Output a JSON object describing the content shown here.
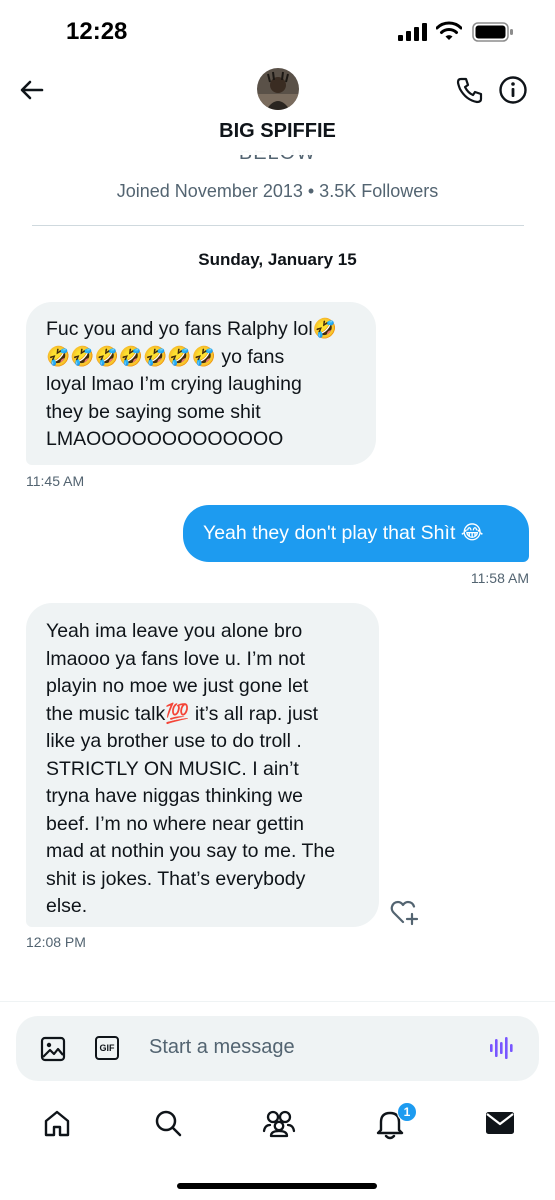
{
  "status_bar": {
    "time": "12:28",
    "icons": [
      "signal-icon",
      "wifi-icon",
      "battery-icon"
    ]
  },
  "header": {
    "contact_name": "BIG SPIFFIE",
    "icons": [
      "back-arrow-icon",
      "avatar",
      "phone-icon",
      "info-icon"
    ]
  },
  "profile": {
    "bio_cut": "BELOW",
    "joined_text": "Joined November 2013 • 3.5K Followers"
  },
  "conversation": {
    "date_separator": "Sunday, January 15",
    "messages": [
      {
        "direction": "incoming",
        "lines": [
          "Fuc you and yo fans Ralphy lol🤣",
          "🤣🤣🤣🤣🤣🤣🤣 yo fans",
          "loyal lmao I’m crying laughing",
          "they be saying some shit",
          "LMAOOOOOOOOOOOOO"
        ],
        "time": "11:45 AM"
      },
      {
        "direction": "outgoing",
        "lines": [
          "Yeah they don't play that Shìt 😂"
        ],
        "time": "11:58 AM"
      },
      {
        "direction": "incoming",
        "lines": [
          "Yeah ima leave you alone bro",
          "lmaooo ya fans love u. I’m not",
          "playin no moe we just gone let",
          "the music talk💯 it’s all rap. just",
          "like ya brother use to do troll .",
          "STRICTLY ON MUSIC. I ain’t",
          "tryna have niggas thinking we",
          "beef. I’m no where near gettin",
          "mad at nothin you say to me. The",
          "shit is jokes. That’s everybody",
          "else."
        ],
        "time": "12:08 PM"
      }
    ]
  },
  "composer": {
    "placeholder": "Start a message",
    "gif_label": "GIF"
  },
  "bottom_nav": {
    "items": [
      "home-icon",
      "search-icon",
      "communities-icon",
      "notifications-icon",
      "messages-icon"
    ],
    "notification_count": "1"
  },
  "colors": {
    "accent": "#1d9bf0",
    "incoming_bubble": "#eff3f4",
    "voice": "#7856ff"
  }
}
